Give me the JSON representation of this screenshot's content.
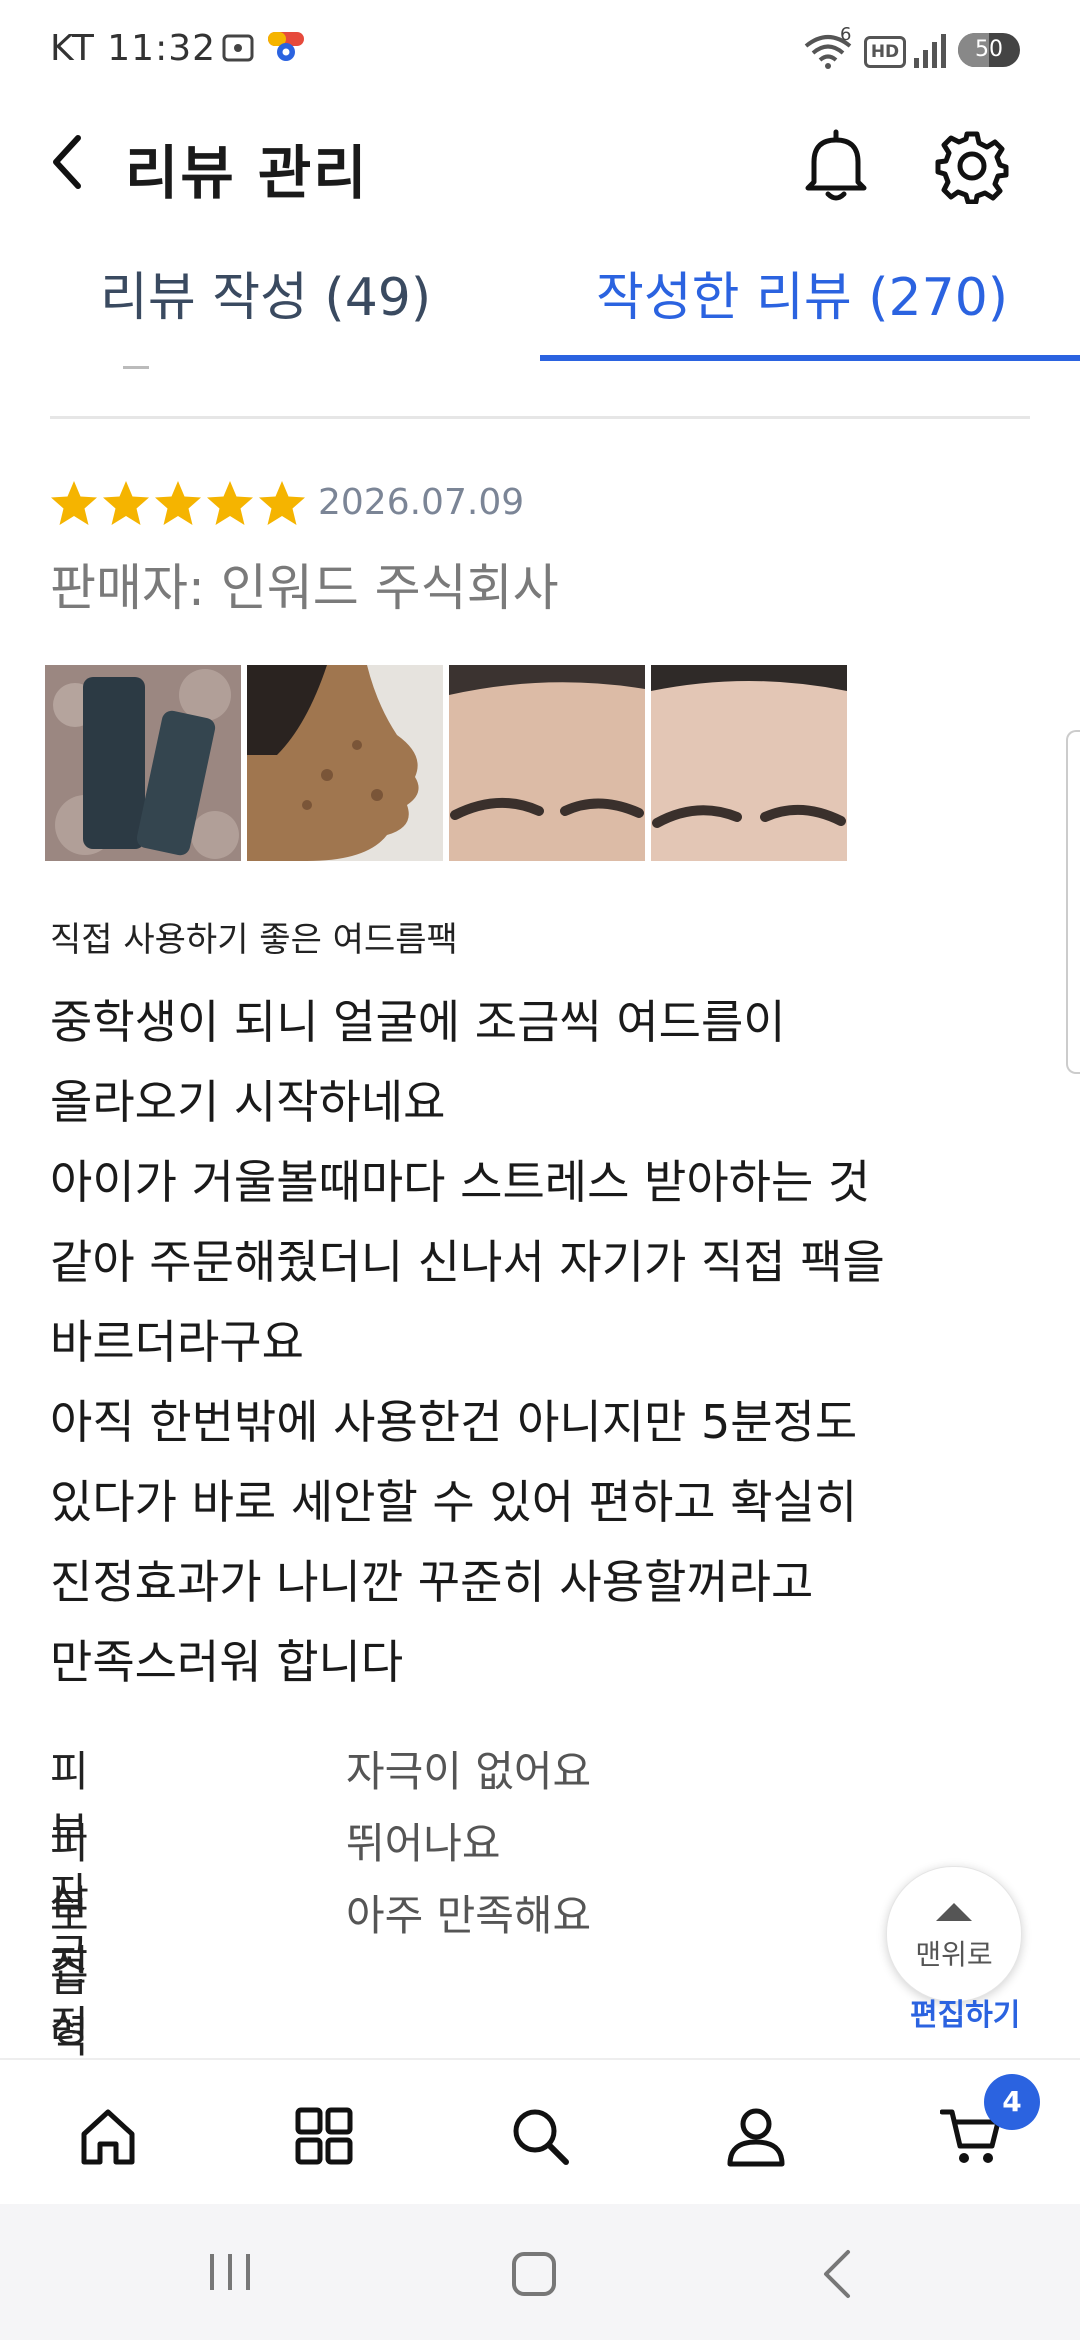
{
  "status_bar": {
    "carrier": "KT",
    "time": "11:32",
    "battery": "50",
    "battery_level": 0.5,
    "signal_label": "6",
    "hd_label": "HD"
  },
  "header": {
    "title": "리뷰 관리"
  },
  "tabs": [
    {
      "label": "리뷰 작성 (49)",
      "active": false
    },
    {
      "label": "작성한 리뷰 (270)",
      "active": true
    }
  ],
  "review": {
    "rating": 5,
    "date": "2026.07.09",
    "seller": "판매자: 인워드 주식회사",
    "photos": [
      "product-photo",
      "face-mask-photo",
      "forehead-photo-1",
      "forehead-photo-2"
    ],
    "headline": "직접 사용하기 좋은 여드름팩",
    "body": "중학생이 되니 얼굴에 조금씩 여드름이\n올라오기 시작하네요\n아이가 거울볼때마다 스트레스 받아하는 것\n같아 주문해줬더니 신나서 자기가 직접 팩을\n바르더라구요\n아직 한번밖에 사용한건 아니지만 5분정도\n있다가 바로 세안할 수 있어 편하고 확실히\n진정효과가 나니깐 꾸준히 사용할꺼라고\n만족스러워 합니다",
    "ratings": [
      {
        "label": "피부 자극",
        "value": "자극이 없어요"
      },
      {
        "label": "피부진정 효과",
        "value": "뛰어나요"
      },
      {
        "label": "보습력",
        "value": "아주 만족해요"
      }
    ]
  },
  "floating": {
    "to_top_label": "맨위로",
    "edit_label": "편집하기"
  },
  "bottom_nav": {
    "items": [
      "home-icon",
      "category-icon",
      "search-icon",
      "account-icon",
      "cart-icon"
    ],
    "cart_count": "4"
  },
  "colors": {
    "accent": "#2b63e0",
    "star": "#f5b400"
  }
}
